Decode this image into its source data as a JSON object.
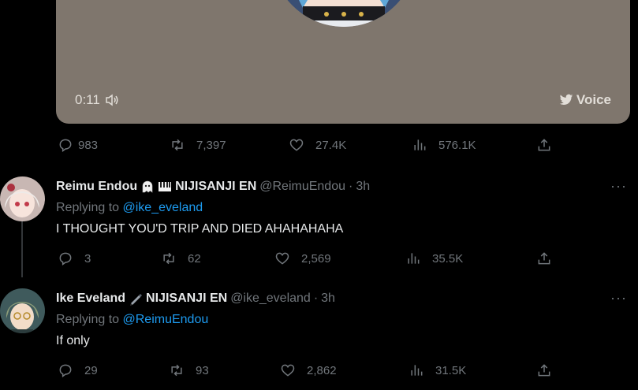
{
  "voice_card": {
    "time": "0:11",
    "badge": "Voice",
    "bg_color": "#7f766d"
  },
  "main_tweet_actions": {
    "replies": "983",
    "retweets": "7,397",
    "likes": "27.4K",
    "views": "576.1K"
  },
  "replies": [
    {
      "display_name": "Reimu Endou",
      "name_suffix": "NIJISANJI EN",
      "handle": "@ReimuEndou",
      "separator": "·",
      "time": "3h",
      "replying_prefix": "Replying to",
      "replying_to": "@ike_eveland",
      "text": "I THOUGHT YOU'D TRIP AND DIED AHAHAHAHA",
      "stats": {
        "replies": "3",
        "retweets": "62",
        "likes": "2,569",
        "views": "35.5K"
      },
      "more": "···"
    },
    {
      "display_name": "Ike Eveland",
      "name_suffix": "NIJISANJI EN",
      "handle": "@ike_eveland",
      "separator": "·",
      "time": "3h",
      "replying_prefix": "Replying to",
      "replying_to": "@ReimuEndou",
      "text": "If only",
      "stats": {
        "replies": "29",
        "retweets": "93",
        "likes": "2,862",
        "views": "31.5K"
      },
      "more": "···"
    }
  ],
  "icons": [
    "speaker-icon",
    "twitter-bird-icon",
    "reply-icon",
    "retweet-icon",
    "like-icon",
    "views-icon",
    "share-icon",
    "ghost-emoji-icon",
    "piano-emoji-icon",
    "pen-emoji-icon",
    "more-icon"
  ]
}
